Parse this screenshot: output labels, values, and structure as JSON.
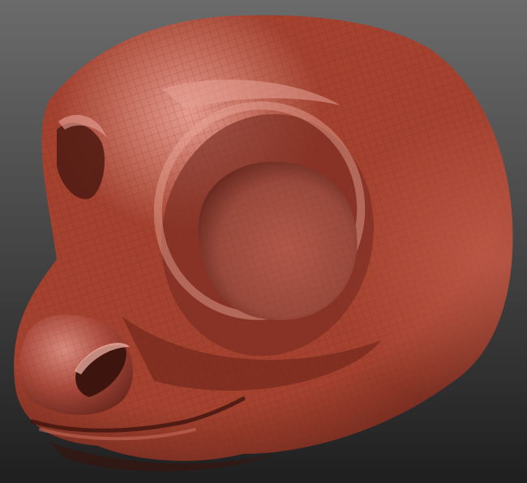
{
  "viewport": {
    "background_top": "#6b6b6b",
    "background_bottom": "#1f1f1f"
  },
  "model": {
    "base_color": "#a4412f",
    "shadow_color": "#4e1a12",
    "highlight_color": "#e49a8d",
    "wire_color": "#6a261b"
  }
}
